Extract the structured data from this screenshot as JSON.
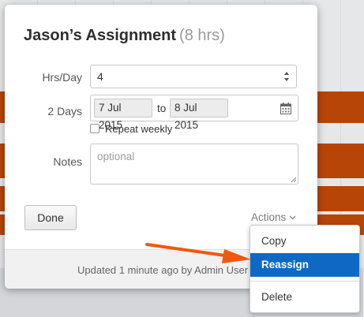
{
  "popover": {
    "title": "Jason’s Assignment",
    "hours": "(8 hrs)",
    "hrs_per_day_label": "Hrs/Day",
    "hrs_per_day_value": "4",
    "days_label": "2 Days",
    "start_date": "7 Jul 2015",
    "to_label": "to",
    "end_date": "8 Jul 2015",
    "repeat_label": "Repeat weekly",
    "notes_label": "Notes",
    "notes_placeholder": "optional",
    "done_label": "Done",
    "actions_label": "Actions",
    "footer_text": "Updated 1 minute ago by Admin User"
  },
  "menu": {
    "items": [
      {
        "label": "Copy"
      },
      {
        "label": "Reassign",
        "highlighted": true
      },
      {
        "label": "Delete"
      }
    ]
  },
  "colors": {
    "highlight": "#0f69c4",
    "arrow": "#f0580f",
    "calendar_bar": "#b84508"
  },
  "icons": [
    "up-down-arrows-icon",
    "calendar-icon",
    "chevron-down-icon",
    "resize-handle-icon",
    "pointer-arrow-icon"
  ]
}
